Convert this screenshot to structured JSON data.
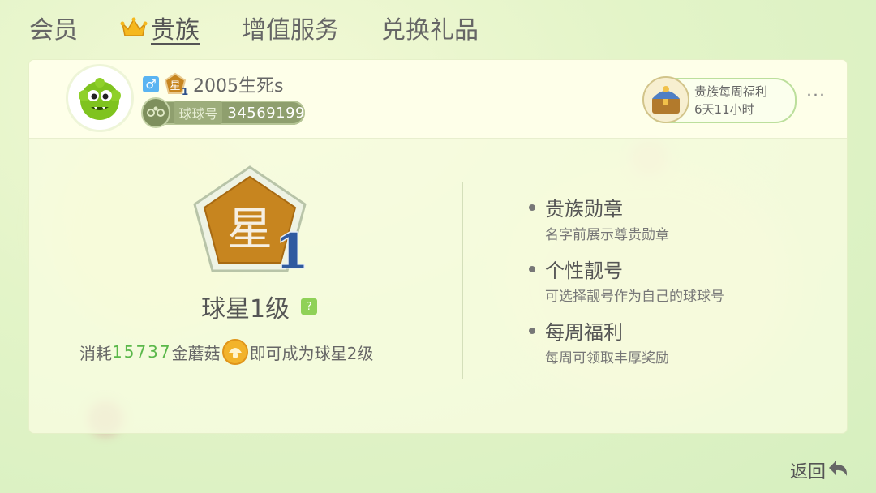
{
  "tabs": [
    {
      "label": "会员",
      "active": false
    },
    {
      "label": "贵族",
      "active": true,
      "icon": "crown-icon"
    },
    {
      "label": "增值服务",
      "active": false
    },
    {
      "label": "兑换礼品",
      "active": false
    }
  ],
  "profile": {
    "gender_icon": "♂",
    "name": "2005生死s",
    "id_label": "球球号",
    "id_number": "34569199",
    "badge_glyph": "星",
    "badge_level": "1"
  },
  "weekly": {
    "title": "贵族每周福利",
    "countdown": "6天11小时"
  },
  "more_label": "···",
  "level": {
    "title": "球星1级",
    "help": "?",
    "badge_glyph": "星",
    "badge_level": "1"
  },
  "consume": {
    "prefix": "消耗",
    "amount": "15737",
    "unit": "金蘑菇",
    "suffix": "即可成为球星2级"
  },
  "perks": [
    {
      "title": "贵族勋章",
      "desc": "名字前展示尊贵勋章"
    },
    {
      "title": "个性靓号",
      "desc": "可选择靓号作为自己的球球号"
    },
    {
      "title": "每周福利",
      "desc": "每周可领取丰厚奖励"
    }
  ],
  "back_label": "返回",
  "colors": {
    "accent_green": "#5ab84a",
    "badge_orange": "#c7851f",
    "male_blue": "#5ab4f2"
  }
}
